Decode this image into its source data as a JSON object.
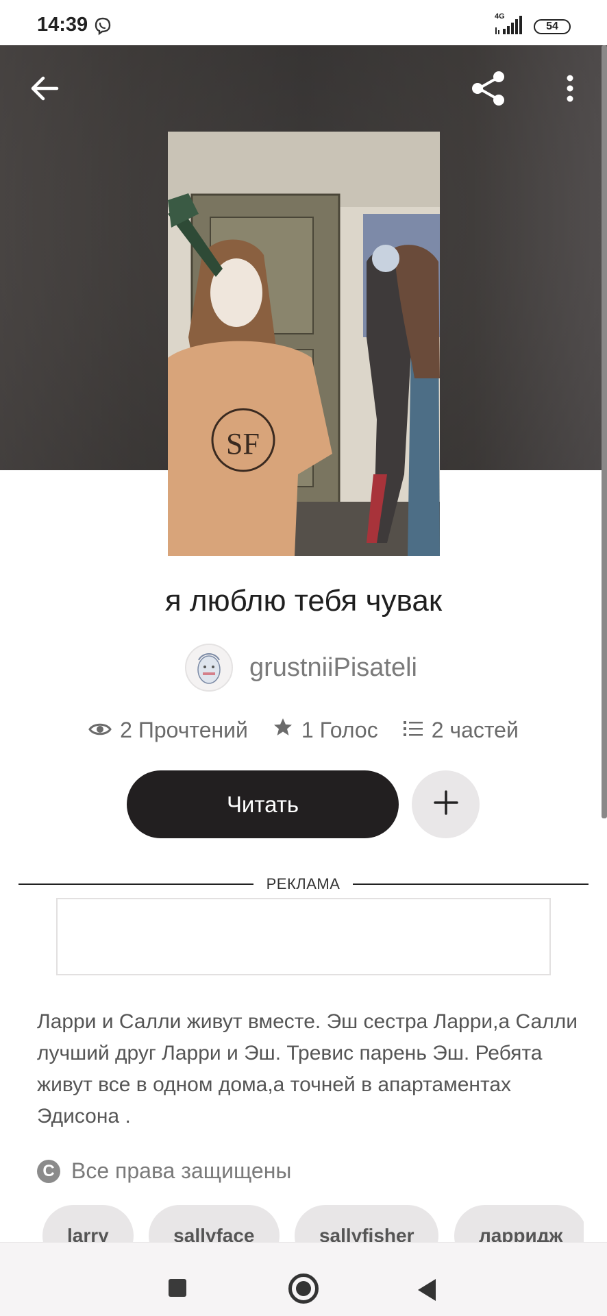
{
  "status": {
    "time": "14:39",
    "network": "4G",
    "battery": "54"
  },
  "story": {
    "title": "я люблю тебя чувак",
    "author": "grustniiPisateli",
    "stats": {
      "reads": "2 Прочтений",
      "votes": "1 Голос",
      "parts": "2 частей"
    },
    "read_label": "Читать",
    "description": "Ларри и Салли живут вместе. Эш сестра Ларри,а Салли лучший друг Ларри и Эш. Тревис парень Эш. Ребята живут все в одном дома,а точней в апартаментах Эдисона .",
    "copyright": "Все права защищены",
    "tags": [
      "larry",
      "sallyface",
      "sallyfisher",
      "ларридж"
    ]
  },
  "ad": {
    "label": "РЕКЛАМА"
  },
  "icons": {
    "back": "arrow-left-icon",
    "share": "share-icon",
    "more": "more-vertical-icon",
    "reads": "eye-icon",
    "votes": "star-icon",
    "parts": "list-icon",
    "add": "plus-icon",
    "copyright": "copyright-icon"
  },
  "colors": {
    "primary_button": "#221f20",
    "secondary_button": "#e9e7e8",
    "hero_bg": "#454140",
    "muted_text": "#6b6b6b"
  }
}
